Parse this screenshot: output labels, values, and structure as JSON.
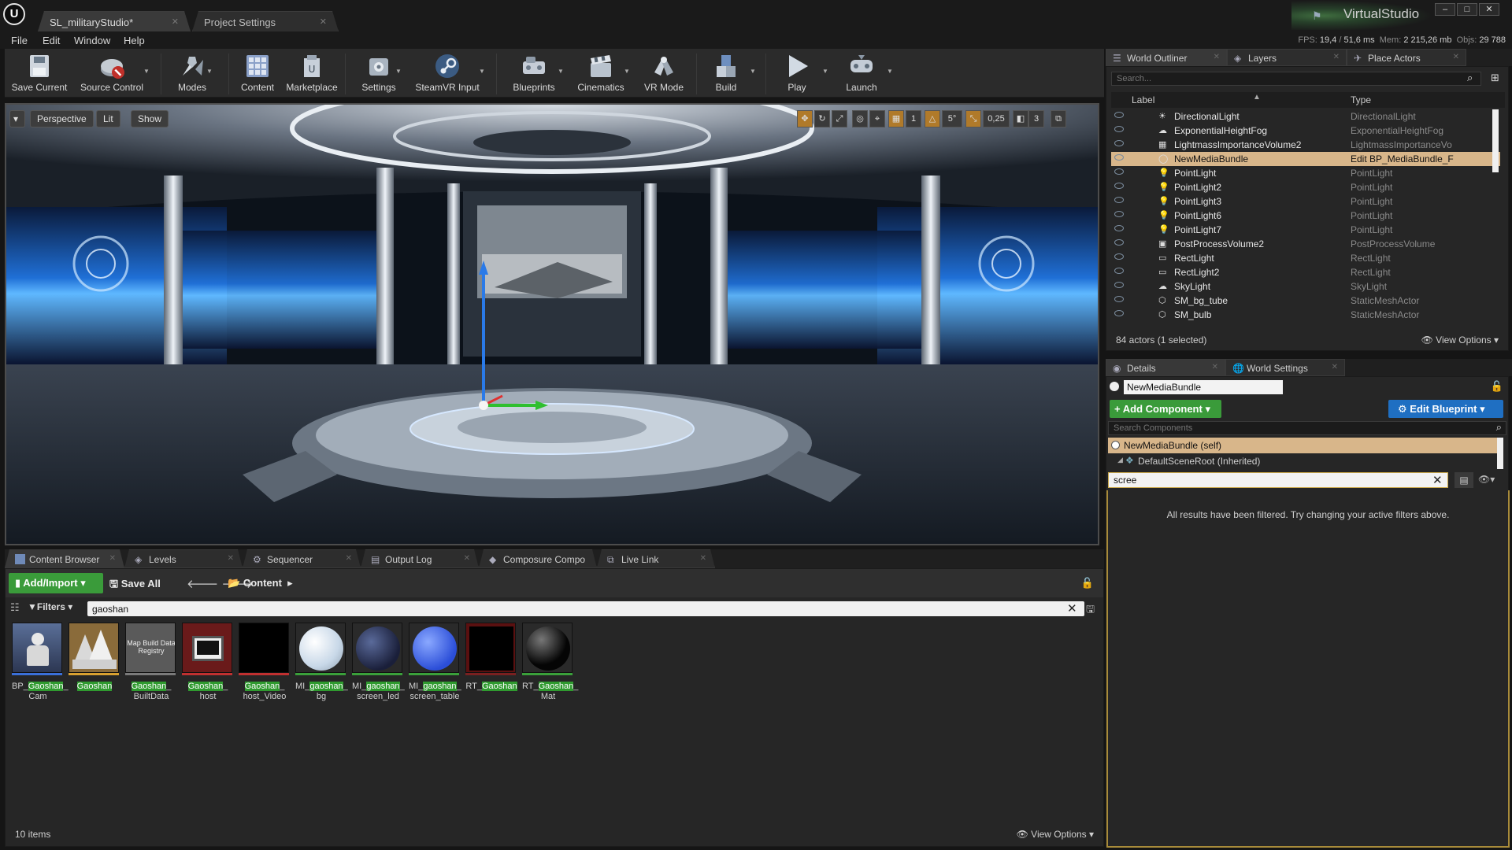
{
  "window": {
    "doc_tabs": [
      "SL_militaryStudio*",
      "Project Settings"
    ],
    "brand": "VirtualStudio",
    "controls": [
      "–",
      "□",
      "✕"
    ]
  },
  "menu": [
    "File",
    "Edit",
    "Window",
    "Help"
  ],
  "stats": {
    "fps_label": "FPS:",
    "fps": "19,4",
    "ms": "51,6 ms",
    "mem_label": "Mem:",
    "mem": "2 215,26 mb",
    "objs_label": "Objs:",
    "objs": "29 788"
  },
  "toolbar": [
    {
      "label": "Save Current",
      "icon": "save-icon"
    },
    {
      "label": "Source Control",
      "icon": "source-control-icon"
    },
    {
      "label": "Modes",
      "icon": "modes-icon"
    },
    {
      "label": "Content",
      "icon": "content-icon"
    },
    {
      "label": "Marketplace",
      "icon": "marketplace-icon"
    },
    {
      "label": "Settings",
      "icon": "settings-icon"
    },
    {
      "label": "SteamVR Input",
      "icon": "steamvr-icon"
    },
    {
      "label": "Blueprints",
      "icon": "blueprints-icon"
    },
    {
      "label": "Cinematics",
      "icon": "cinematics-icon"
    },
    {
      "label": "VR Mode",
      "icon": "vr-mode-icon"
    },
    {
      "label": "Build",
      "icon": "build-icon"
    },
    {
      "label": "Play",
      "icon": "play-icon"
    },
    {
      "label": "Launch",
      "icon": "launch-icon"
    }
  ],
  "viewport": {
    "perspective": "Perspective",
    "lit": "Lit",
    "show": "Show",
    "snap_angle": "5°",
    "grid": "1",
    "scale_snap": "0,25",
    "camera_speed": "3"
  },
  "bottom_tabs": [
    "Content Browser",
    "Levels",
    "Sequencer",
    "Output Log",
    "Composure Compo",
    "Live Link"
  ],
  "content_browser": {
    "add_import": "Add/Import",
    "save_all": "Save All",
    "path": "Content",
    "filters": "Filters",
    "search": "gaoshan",
    "count": "10 items",
    "view_options": "View Options",
    "assets": [
      {
        "pre": "BP_",
        "hl": "Gaoshan",
        "post": "_",
        "line2": "Cam",
        "bar": "#3a6fd8"
      },
      {
        "pre": "",
        "hl": "Gaoshan",
        "post": "",
        "line2": "",
        "bar": "#d8a030"
      },
      {
        "pre": "",
        "hl": "Gaoshan",
        "post": "_",
        "line2": "BuiltData",
        "bar": "#7a7a7a",
        "thumb_text": "Map Build Data Registry"
      },
      {
        "pre": "",
        "hl": "Gaoshan",
        "post": "_",
        "line2": "host",
        "bar": "#c03030"
      },
      {
        "pre": "",
        "hl": "Gaoshan",
        "post": "_",
        "line2": "host_Video",
        "bar": "#c03030"
      },
      {
        "pre": "MI_",
        "hl": "gaoshan",
        "post": "_",
        "line2": "bg",
        "bar": "#3aa03a"
      },
      {
        "pre": "MI_",
        "hl": "gaoshan",
        "post": "_",
        "line2": "screen_led",
        "bar": "#3aa03a"
      },
      {
        "pre": "MI_",
        "hl": "gaoshan",
        "post": "_",
        "line2": "screen_table",
        "bar": "#3aa03a"
      },
      {
        "pre": "RT_",
        "hl": "Gaoshan",
        "post": "",
        "line2": "",
        "bar": "#7a2020"
      },
      {
        "pre": "RT_",
        "hl": "Gaoshan",
        "post": "_",
        "line2": "Mat",
        "bar": "#3aa03a"
      }
    ]
  },
  "outliner": {
    "tabs": [
      "World Outliner",
      "Layers",
      "Place Actors"
    ],
    "search_placeholder": "Search...",
    "col_label": "Label",
    "col_type": "Type",
    "rows": [
      {
        "label": "DirectionalLight",
        "type": "DirectionalLight"
      },
      {
        "label": "ExponentialHeightFog",
        "type": "ExponentialHeightFog"
      },
      {
        "label": "LightmassImportanceVolume2",
        "type": "LightmassImportanceVo"
      },
      {
        "label": "NewMediaBundle",
        "type": "Edit BP_MediaBundle_F",
        "selected": true
      },
      {
        "label": "PointLight",
        "type": "PointLight"
      },
      {
        "label": "PointLight2",
        "type": "PointLight"
      },
      {
        "label": "PointLight3",
        "type": "PointLight"
      },
      {
        "label": "PointLight6",
        "type": "PointLight"
      },
      {
        "label": "PointLight7",
        "type": "PointLight"
      },
      {
        "label": "PostProcessVolume2",
        "type": "PostProcessVolume"
      },
      {
        "label": "RectLight",
        "type": "RectLight"
      },
      {
        "label": "RectLight2",
        "type": "RectLight"
      },
      {
        "label": "SkyLight",
        "type": "SkyLight"
      },
      {
        "label": "SM_bg_tube",
        "type": "StaticMeshActor"
      },
      {
        "label": "SM_bulb",
        "type": "StaticMeshActor"
      }
    ],
    "count": "84 actors (1 selected)",
    "view_options": "View Options"
  },
  "details": {
    "tabs": [
      "Details",
      "World Settings"
    ],
    "name": "NewMediaBundle",
    "add_component": "Add Component",
    "edit_blueprint": "Edit Blueprint",
    "search_components": "Search Components",
    "self": "NewMediaBundle (self)",
    "root": "DefaultSceneRoot (Inherited)",
    "filter": "scree",
    "filtered_msg": "All results have been filtered. Try changing your active filters above."
  }
}
